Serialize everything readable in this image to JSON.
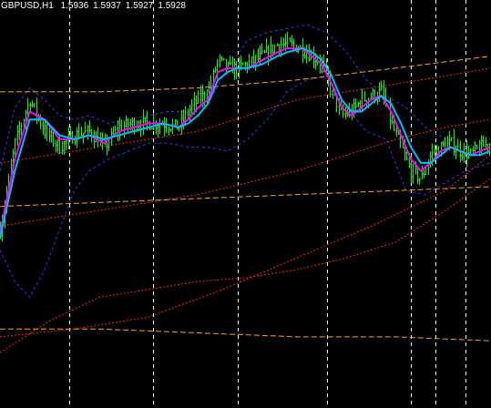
{
  "header": {
    "symbol_timeframe": "GBPUSD,H1",
    "open": "1.5936",
    "high": "1.5937",
    "low": "1.5927",
    "close": "1.5928"
  },
  "colors": {
    "background": "#000000",
    "candles": "#00ff00",
    "ma_fast": "#ff00ff",
    "ma_slow": "#00bfff",
    "bands_inner": "#ff2020",
    "bands_outer": "#3333ff",
    "envelope": "#ffa500",
    "period_separator": "#ffffff"
  },
  "chart_data": {
    "type": "candlestick",
    "symbol": "GBPUSD",
    "timeframe": "H1",
    "ylim": [
      0,
      100
    ],
    "grid": false,
    "legend": "none",
    "x_count": 100,
    "period_separators_at": [
      14,
      31,
      48,
      66,
      83,
      88,
      94
    ],
    "price_path": [
      [
        0,
        45
      ],
      [
        3,
        67
      ],
      [
        6,
        78
      ],
      [
        9,
        70
      ],
      [
        12,
        66
      ],
      [
        15,
        69
      ],
      [
        18,
        70
      ],
      [
        21,
        66
      ],
      [
        24,
        71
      ],
      [
        27,
        72
      ],
      [
        30,
        72
      ],
      [
        33,
        72
      ],
      [
        36,
        71
      ],
      [
        38,
        75
      ],
      [
        40,
        78
      ],
      [
        42,
        80
      ],
      [
        44,
        88
      ],
      [
        46,
        86
      ],
      [
        48,
        86
      ],
      [
        50,
        87
      ],
      [
        53,
        89
      ],
      [
        56,
        92
      ],
      [
        58,
        92
      ],
      [
        61,
        91
      ],
      [
        63,
        89
      ],
      [
        65,
        87
      ],
      [
        67,
        80
      ],
      [
        69,
        74
      ],
      [
        71,
        75
      ],
      [
        73,
        78
      ],
      [
        75,
        79
      ],
      [
        77,
        80
      ],
      [
        79,
        72
      ],
      [
        81,
        66
      ],
      [
        83,
        60
      ],
      [
        85,
        58
      ],
      [
        87,
        64
      ],
      [
        89,
        66
      ],
      [
        91,
        67
      ],
      [
        93,
        65
      ],
      [
        95,
        64
      ],
      [
        97,
        66
      ],
      [
        99,
        67
      ]
    ],
    "series": [
      {
        "style": "ma_fast",
        "x": [
          0,
          3,
          6,
          9,
          12,
          15,
          18,
          21,
          24,
          27,
          30,
          33,
          36,
          38,
          40,
          42,
          44,
          46,
          48,
          50,
          53,
          56,
          58,
          61,
          63,
          65,
          67,
          69,
          71,
          73,
          75,
          77,
          79,
          81,
          83,
          85,
          87,
          89,
          91,
          93,
          95,
          97,
          99
        ],
        "values": [
          44,
          63,
          75,
          73,
          68,
          68,
          69,
          67,
          70,
          71,
          72,
          72,
          71,
          73,
          76,
          78,
          85,
          86,
          86,
          86,
          88,
          90,
          91,
          91,
          89,
          87,
          82,
          76,
          74,
          76,
          78,
          79,
          75,
          69,
          63,
          60,
          62,
          65,
          66,
          65,
          64,
          65,
          66
        ]
      },
      {
        "style": "ma_slow",
        "x": [
          0,
          3,
          6,
          9,
          12,
          15,
          18,
          21,
          24,
          27,
          30,
          33,
          36,
          38,
          40,
          42,
          44,
          46,
          48,
          50,
          53,
          56,
          58,
          61,
          63,
          65,
          67,
          69,
          71,
          73,
          75,
          77,
          79,
          81,
          83,
          85,
          87,
          89,
          91,
          93,
          95,
          97,
          99
        ],
        "values": [
          43,
          60,
          73,
          73,
          69,
          68,
          69,
          68,
          69,
          70,
          71,
          72,
          71,
          72,
          74,
          77,
          83,
          85,
          86,
          86,
          87,
          89,
          90,
          91,
          90,
          88,
          84,
          78,
          75,
          75,
          77,
          79,
          77,
          72,
          66,
          62,
          62,
          64,
          66,
          65,
          64,
          64,
          65
        ]
      },
      {
        "style": "bands_inner",
        "x": [
          0,
          20,
          40,
          60,
          70,
          80,
          90,
          99
        ],
        "values": [
          62,
          66,
          70,
          78,
          80,
          82,
          84,
          86
        ]
      },
      {
        "style": "bands_inner",
        "x": [
          0,
          20,
          40,
          60,
          70,
          80,
          90,
          99
        ],
        "values": [
          46,
          50,
          54,
          60,
          64,
          68,
          71,
          73
        ]
      },
      {
        "style": "bands_inner",
        "x": [
          0,
          10,
          20,
          30,
          40,
          50,
          60,
          70,
          80,
          90,
          99
        ],
        "values": [
          14,
          22,
          28,
          30,
          32,
          33,
          35,
          38,
          42,
          50,
          58
        ]
      },
      {
        "style": "bands_inner",
        "x": [
          0,
          15,
          30,
          45,
          60,
          75,
          90,
          99
        ],
        "values": [
          18,
          20,
          23,
          30,
          38,
          46,
          55,
          64
        ]
      },
      {
        "style": "bands_outer",
        "x": [
          0,
          3,
          6,
          9,
          12,
          15,
          18,
          22,
          26,
          30,
          34,
          38,
          42,
          46,
          50,
          54,
          58,
          62,
          66,
          70,
          74,
          78,
          82,
          86,
          90,
          94,
          99
        ],
        "values": [
          60,
          76,
          81,
          78,
          74,
          73,
          74,
          72,
          73,
          74,
          75,
          75,
          77,
          86,
          93,
          95,
          96,
          97,
          95,
          90,
          83,
          79,
          76,
          71,
          68,
          66,
          68
        ]
      },
      {
        "style": "bands_outer",
        "x": [
          0,
          3,
          6,
          9,
          12,
          15,
          18,
          22,
          26,
          30,
          34,
          38,
          42,
          46,
          50,
          54,
          58,
          62,
          66,
          70,
          74,
          78,
          82,
          86,
          90,
          94,
          99
        ],
        "values": [
          40,
          32,
          28,
          35,
          45,
          55,
          60,
          63,
          65,
          67,
          67,
          66,
          66,
          65,
          68,
          73,
          80,
          83,
          84,
          76,
          70,
          68,
          55,
          54,
          57,
          60,
          62
        ]
      },
      {
        "style": "envelope",
        "x": [
          0,
          20,
          40,
          60,
          80,
          99
        ],
        "values": [
          80,
          80,
          81,
          83,
          86,
          89
        ]
      },
      {
        "style": "envelope",
        "x": [
          0,
          20,
          40,
          60,
          80,
          99
        ],
        "values": [
          51,
          52,
          53,
          54,
          55,
          56
        ]
      },
      {
        "style": "envelope",
        "x": [
          0,
          20,
          40,
          60,
          80,
          99
        ],
        "values": [
          20,
          20,
          19,
          18,
          18,
          17
        ]
      }
    ]
  }
}
